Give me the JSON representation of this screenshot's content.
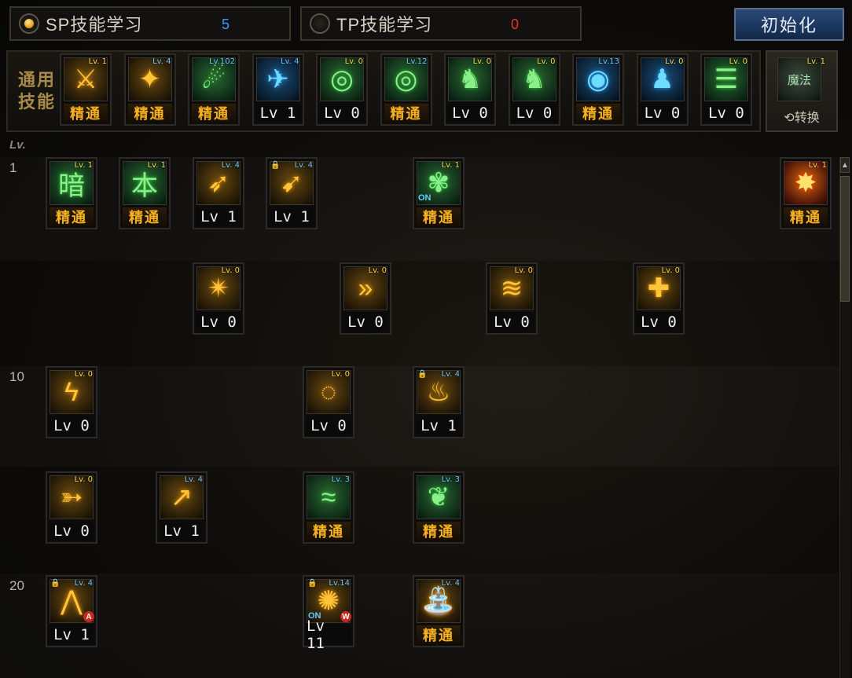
{
  "tabs": {
    "sp": {
      "label": "SP技能学习",
      "value": "5",
      "value_color": "#3d9bff",
      "selected": true
    },
    "tp": {
      "label": "TP技能学习",
      "value": "0",
      "value_color": "#e0342a",
      "selected": false
    }
  },
  "reset_label": "初始化",
  "common": {
    "label": "通用技能",
    "switch_label": "⟲转换",
    "switch_icon": {
      "text": "魔法",
      "lv": "Lv. 1"
    },
    "skills": [
      {
        "icon": "gold",
        "glyph": "⚔",
        "tag": "Lv. 1",
        "tag_color": "gold",
        "foot": "精通",
        "mastered": true
      },
      {
        "icon": "gold",
        "glyph": "✦",
        "tag": "Lv. 4",
        "tag_color": "blue",
        "foot": "精通",
        "mastered": true
      },
      {
        "icon": "green",
        "glyph": "☄",
        "tag": "Lv.102",
        "tag_color": "blue",
        "foot": "精通",
        "mastered": true
      },
      {
        "icon": "blue",
        "glyph": "✈",
        "tag": "Lv. 4",
        "tag_color": "blue",
        "foot": "Lv 1",
        "mastered": false
      },
      {
        "icon": "green",
        "glyph": "◎",
        "tag": "Lv. 0",
        "tag_color": "gold",
        "foot": "Lv 0",
        "mastered": false
      },
      {
        "icon": "green",
        "glyph": "◎",
        "tag": "Lv.12",
        "tag_color": "blue",
        "foot": "精通",
        "mastered": true
      },
      {
        "icon": "green",
        "glyph": "♞",
        "tag": "Lv. 0",
        "tag_color": "gold",
        "foot": "Lv 0",
        "mastered": false
      },
      {
        "icon": "green",
        "glyph": "♞",
        "tag": "Lv. 0",
        "tag_color": "gold",
        "foot": "Lv 0",
        "mastered": false
      },
      {
        "icon": "blue",
        "glyph": "◉",
        "tag": "Lv.13",
        "tag_color": "blue",
        "foot": "精通",
        "mastered": true
      },
      {
        "icon": "blue",
        "glyph": "♟",
        "tag": "Lv. 0",
        "tag_color": "gold",
        "foot": "Lv 0",
        "mastered": false
      },
      {
        "icon": "green",
        "glyph": "☰",
        "tag": "Lv. 0",
        "tag_color": "gold",
        "foot": "Lv 0",
        "mastered": false
      }
    ]
  },
  "tree": {
    "lv_header": "Lv.",
    "row_levels": [
      "1",
      "10",
      "20"
    ],
    "rows": [
      [
        {
          "col": 0,
          "icon": "green",
          "glyph": "暗",
          "tag": "Lv. 1",
          "tag_color": "gold",
          "foot": "精通",
          "mastered": true
        },
        {
          "col": 1,
          "icon": "green",
          "glyph": "本",
          "tag": "Lv. 1",
          "tag_color": "gold",
          "foot": "精通",
          "mastered": true
        },
        {
          "col": 2,
          "icon": "gold",
          "glyph": "➶",
          "tag": "Lv. 4",
          "tag_color": "blue",
          "foot": "Lv 1",
          "mastered": false
        },
        {
          "col": 3,
          "icon": "gold",
          "glyph": "➹",
          "tag": "Lv. 4",
          "tag_color": "blue",
          "lock": true,
          "foot": "Lv 1",
          "mastered": false
        },
        {
          "col": 5,
          "icon": "green",
          "glyph": "✾",
          "tag": "Lv. 1",
          "tag_color": "gold",
          "on": "ON",
          "foot": "精通",
          "mastered": true
        },
        {
          "col": 10,
          "icon": "fire",
          "glyph": "✸",
          "tag": "Lv. 1",
          "tag_color": "gold",
          "foot": "精通",
          "mastered": true
        }
      ],
      [
        {
          "col": 2,
          "icon": "gold",
          "glyph": "✴",
          "tag": "Lv. 0",
          "tag_color": "gold",
          "foot": "Lv 0",
          "mastered": false
        },
        {
          "col": 4,
          "icon": "gold",
          "glyph": "»",
          "tag": "Lv. 0",
          "tag_color": "gold",
          "foot": "Lv 0",
          "mastered": false
        },
        {
          "col": 6,
          "icon": "gold",
          "glyph": "≋",
          "tag": "Lv. 0",
          "tag_color": "gold",
          "foot": "Lv 0",
          "mastered": false
        },
        {
          "col": 8,
          "icon": "gold",
          "glyph": "✚",
          "tag": "Lv. 0",
          "tag_color": "gold",
          "foot": "Lv 0",
          "mastered": false
        }
      ],
      [
        {
          "col": 0,
          "icon": "gold",
          "glyph": "ϟ",
          "tag": "Lv. 0",
          "tag_color": "gold",
          "foot": "Lv 0",
          "mastered": false
        },
        {
          "col": 3.5,
          "icon": "gold",
          "glyph": "◌",
          "tag": "Lv. 0",
          "tag_color": "gold",
          "foot": "Lv 0",
          "mastered": false
        },
        {
          "col": 5,
          "icon": "gold",
          "glyph": "♨",
          "tag": "Lv. 4",
          "tag_color": "blue",
          "lock": true,
          "foot": "Lv 1",
          "mastered": false
        }
      ],
      [
        {
          "col": 0,
          "icon": "gold",
          "glyph": "➳",
          "tag": "Lv. 0",
          "tag_color": "gold",
          "foot": "Lv 0",
          "mastered": false
        },
        {
          "col": 1.5,
          "icon": "gold",
          "glyph": "↗",
          "tag": "Lv. 4",
          "tag_color": "blue",
          "foot": "Lv 1",
          "mastered": false
        },
        {
          "col": 3.5,
          "icon": "green",
          "glyph": "≈",
          "tag": "Lv. 3",
          "tag_color": "blue",
          "foot": "精通",
          "mastered": true
        },
        {
          "col": 5,
          "icon": "green",
          "glyph": "❦",
          "tag": "Lv. 3",
          "tag_color": "blue",
          "foot": "精通",
          "mastered": true
        }
      ],
      [
        {
          "col": 0,
          "icon": "gold",
          "glyph": "⋀",
          "tag": "Lv. 4",
          "tag_color": "blue",
          "lock": true,
          "badge": "A",
          "foot": "Lv 1",
          "mastered": false
        },
        {
          "col": 3.5,
          "icon": "gold",
          "glyph": "✺",
          "tag": "Lv.14",
          "tag_color": "blue",
          "lock": true,
          "on": "ON",
          "badge": "W",
          "foot": "Lv 11",
          "mastered": false
        },
        {
          "col": 5,
          "icon": "gold",
          "glyph": "⛲",
          "tag": "Lv. 4",
          "tag_color": "blue",
          "foot": "精通",
          "mastered": true
        }
      ]
    ]
  }
}
